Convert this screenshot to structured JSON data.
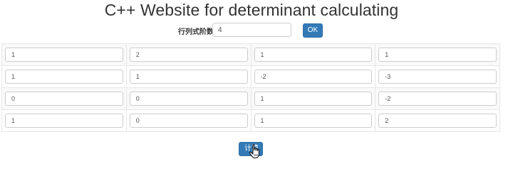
{
  "page": {
    "title": "C++ Website for determinant calculating"
  },
  "order": {
    "label": "行列式阶数",
    "value": "4",
    "ok_label": "OK"
  },
  "matrix": {
    "rows": [
      [
        "1",
        "2",
        "1",
        "1"
      ],
      [
        "1",
        "1",
        "-2",
        "-3"
      ],
      [
        "0",
        "0",
        "1",
        "-2"
      ],
      [
        "1",
        "0",
        "1",
        "2"
      ]
    ]
  },
  "calculate": {
    "label": "计算"
  },
  "colors": {
    "primary_button": "#337ab7",
    "table_stripe": "#f9f9f9",
    "border": "#cccccc"
  },
  "icons": {
    "cursor": "hand-pointer-icon"
  }
}
